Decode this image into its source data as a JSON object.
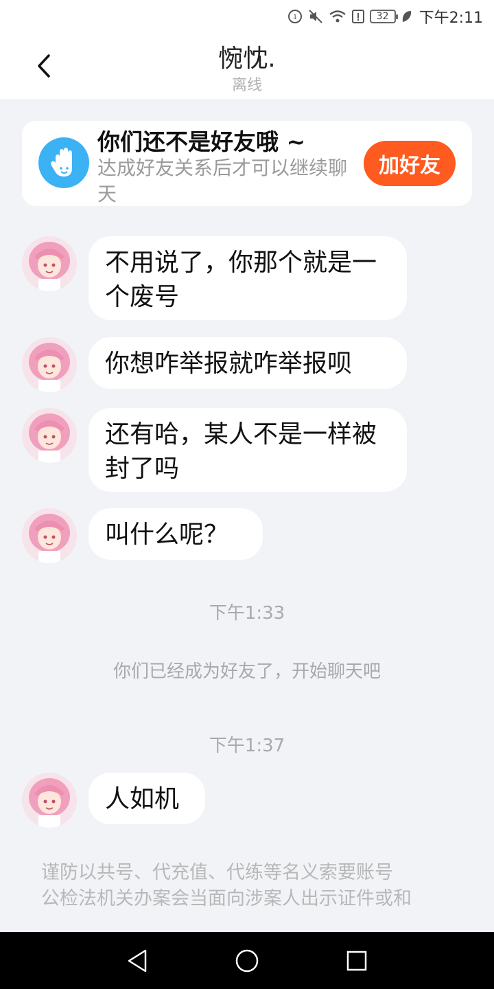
{
  "status_bar": {
    "time": "下午2:11",
    "battery": "32"
  },
  "header": {
    "title": "惋忱.",
    "status": "离线"
  },
  "friend_card": {
    "title": "你们还不是好友哦 ~",
    "description": "达成好友关系后才可以继续聊天",
    "button_label": "加好友"
  },
  "messages": [
    {
      "text": "不用说了，你那个就是一个废号"
    },
    {
      "text": "你想咋举报就咋举报呗"
    },
    {
      "text": "还有哈，某人不是一样被封了吗"
    },
    {
      "text": "叫什么呢？"
    },
    {
      "text": "人如机"
    }
  ],
  "timestamps": [
    "下午1:33",
    "下午1:37"
  ],
  "system_message": "你们已经成为好友了，开始聊天吧",
  "notice": {
    "line1": "谨防以共号、代充值、代练等名义索要账号",
    "line2": "公检法机关办案会当面向涉案人出示证件或和"
  },
  "colors": {
    "accent": "#ff5a1f",
    "hand_icon": "#3ab2f4",
    "background": "#f2f3f7"
  },
  "icons": [
    "back-icon",
    "hand-icon",
    "avatar",
    "nav-back-icon",
    "nav-home-icon",
    "nav-recents-icon"
  ]
}
